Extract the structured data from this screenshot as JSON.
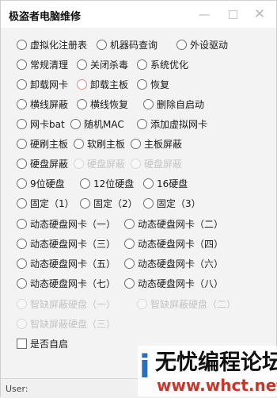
{
  "window": {
    "title": "极盗者电脑维修"
  },
  "options": [
    {
      "label": "虚拟化注册表"
    },
    {
      "label": "机器码查询"
    },
    {
      "label": "外设驱动"
    },
    {
      "label": "常规清理"
    },
    {
      "label": "关闭杀毒"
    },
    {
      "label": "系统优化"
    },
    {
      "label": "卸载网卡"
    },
    {
      "label": "卸载主板"
    },
    {
      "label": "恢复"
    },
    {
      "label": "横线屏蔽"
    },
    {
      "label": "横线恢复"
    },
    {
      "label": "删除自启动"
    },
    {
      "label": "网卡bat"
    },
    {
      "label": "随机MAC"
    },
    {
      "label": "添加虚拟网卡"
    },
    {
      "label": "硬刷主板"
    },
    {
      "label": "软刷主板"
    },
    {
      "label": "主板屏蔽"
    },
    {
      "label": "硬盘屏蔽"
    },
    {
      "label": "硬盘屏蔽",
      "disabled": true
    },
    {
      "label": "硬盘屏蔽",
      "disabled": true
    },
    {
      "label": "9位硬盘"
    },
    {
      "label": "12位硬盘"
    },
    {
      "label": "16硬盘"
    },
    {
      "label": "固定（1）"
    },
    {
      "label": "固定（2）"
    },
    {
      "label": "固定（3）"
    },
    {
      "label": "动态硬盘网卡（一）"
    },
    {
      "label": "动态硬盘网卡（二）"
    },
    {
      "label": "动态硬盘网卡（三）"
    },
    {
      "label": "动态硬盘网卡（四）"
    },
    {
      "label": "动态硬盘网卡（五）"
    },
    {
      "label": "动态硬盘网卡（六）"
    },
    {
      "label": "动态硬盘网卡（七）"
    },
    {
      "label": "动态硬盘网卡（八）"
    },
    {
      "label": "智缺屏蔽硬盘（一）",
      "disabled": true
    },
    {
      "label": "智缺屏蔽硬盘（二）",
      "disabled": true
    },
    {
      "label": "智缺屏蔽硬盘（三）",
      "disabled": true
    }
  ],
  "autostart": {
    "label": "是否自启"
  },
  "status": {
    "label": "User:",
    "value": ""
  },
  "watermark": {
    "line1": "无忧编程论坛",
    "line2": "www.whct.net"
  }
}
